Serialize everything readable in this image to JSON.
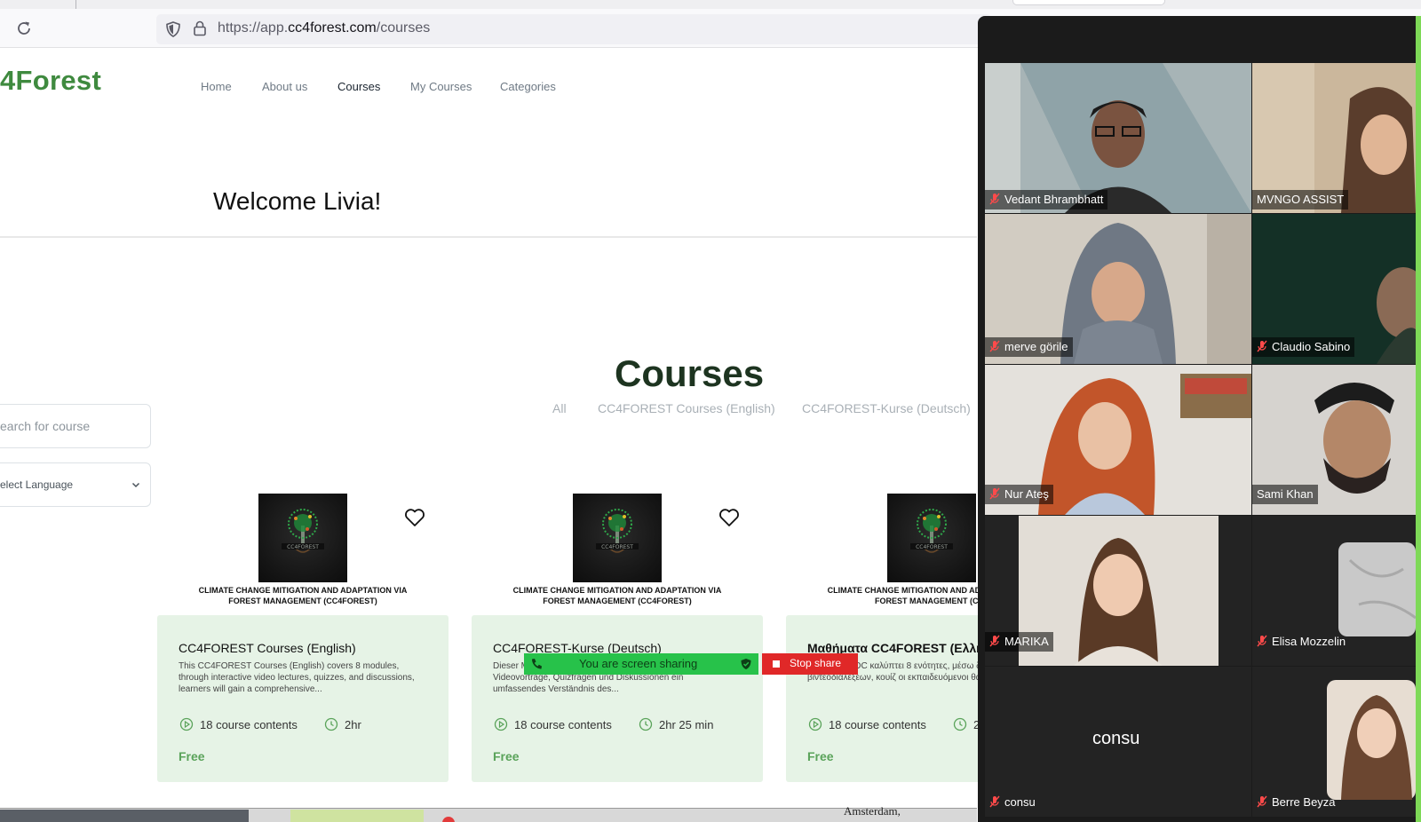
{
  "browser": {
    "url_prefix": "https://app.",
    "url_domain": "cc4forest.com",
    "url_path": "/courses"
  },
  "site": {
    "logo": "4Forest",
    "nav": [
      "Home",
      "About us",
      "Courses",
      "My Courses",
      "Categories"
    ],
    "active_nav": "Courses",
    "welcome": "Welcome Livia!",
    "colors": {
      "brand_green": "#3f8a3f",
      "card_bg": "#e6f3e6",
      "price_green": "#5aa35a"
    }
  },
  "courses": {
    "title": "Courses",
    "filters": [
      "All",
      "CC4FOREST Courses (English)",
      "CC4FOREST-Kurse (Deutsch)"
    ],
    "search_placeholder": "earch for course",
    "language_placeholder": "elect Language",
    "cards": [
      {
        "caption": "CLIMATE CHANGE MITIGATION AND ADAPTATION VIA FOREST MANAGEMENT (CC4FOREST)",
        "title": "CC4FOREST Courses (English)",
        "description": "This CC4FOREST Courses (English) covers 8 modules, through interactive video lectures, quizzes, and discussions, learners will gain a comprehensive...",
        "contents": "18 course contents",
        "duration": "2hr",
        "price": "Free"
      },
      {
        "caption": "CLIMATE CHANGE MITIGATION AND ADAPTATION VIA FOREST MANAGEMENT (CC4FOREST)",
        "title": "CC4FOREST-Kurse (Deutsch)",
        "description": "Dieser MOOC umfasst 8 Module. Durch interaktive Videovorträge, Quizfragen und Diskussionen ein umfassendes Verständnis des...",
        "contents": "18 course contents",
        "duration": "2hr 25 min",
        "price": "Free"
      },
      {
        "caption": "CLIMATE CHANGE MITIGATION AND ADAPTATION VIA FOREST MANAGEMENT (CC4",
        "title": "Μαθήματα CC4FOREST (Ελλη",
        "description": "Αυτό το MOOC καλύπτει 8 ενότητες, μέσω διαδραστικών βιντεοδιαλέξεων, κουίζ οι εκπαιδευόμενοι θα αποκτήσουν μια",
        "contents": "18 course contents",
        "duration": "2",
        "price": "Free"
      }
    ]
  },
  "screen_share": {
    "status": "You are screen sharing",
    "stop_label": "Stop share",
    "colors": {
      "bar": "#27c24a",
      "stop": "#e02828"
    }
  },
  "bottom": {
    "text": "Amsterdam,"
  },
  "zoom": {
    "participants": [
      {
        "name": "Vedant Bhrambhatt",
        "muted": true
      },
      {
        "name": "MVNGO ASSIST",
        "muted": false,
        "active_speaker": true
      },
      {
        "name": "merve görile",
        "muted": true
      },
      {
        "name": "Claudio Sabino",
        "muted": true
      },
      {
        "name": "Nur Ateş",
        "muted": true
      },
      {
        "name": "Sami Khan",
        "muted": false
      },
      {
        "name": "MARIKA",
        "muted": true
      },
      {
        "name": "Elisa Mozzelin",
        "muted": true
      },
      {
        "name": "consu",
        "muted": true,
        "video_off_label": "consu"
      },
      {
        "name": "Berre Beyza",
        "muted": true
      }
    ]
  }
}
